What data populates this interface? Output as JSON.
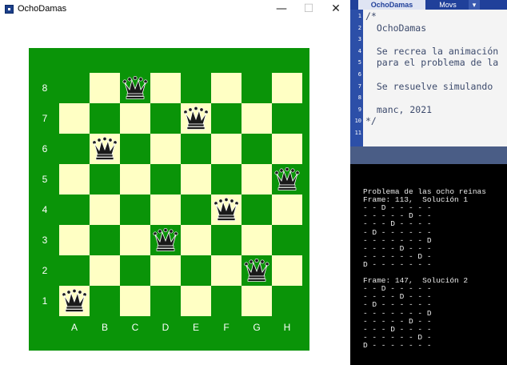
{
  "window": {
    "title": "OchoDamas",
    "minimize": "—",
    "maximize": "☐",
    "close": "✕"
  },
  "board": {
    "rank_labels": [
      "8",
      "7",
      "6",
      "5",
      "4",
      "3",
      "2",
      "1"
    ],
    "file_labels": [
      "A",
      "B",
      "C",
      "D",
      "E",
      "F",
      "G",
      "H"
    ],
    "queens": [
      {
        "file": "A",
        "rank": 1
      },
      {
        "file": "B",
        "rank": 6
      },
      {
        "file": "C",
        "rank": 8
      },
      {
        "file": "D",
        "rank": 3
      },
      {
        "file": "E",
        "rank": 7
      },
      {
        "file": "F",
        "rank": 4
      },
      {
        "file": "G",
        "rank": 2
      },
      {
        "file": "H",
        "rank": 5
      }
    ],
    "colors": {
      "border": "#0a9408",
      "dark": "#0a9408",
      "light": "#ffffc4",
      "label": "#ffffff",
      "queen": "#1a1a1a"
    }
  },
  "editor": {
    "tabs": {
      "file": "OchoDamas",
      "movs": "Movs",
      "arrow": "▾"
    },
    "line_numbers": [
      "1",
      "2",
      "3",
      "4",
      "5",
      "6",
      "7",
      "8",
      "9",
      "10",
      "11"
    ],
    "lines": [
      "/*",
      "  OchoDamas",
      "",
      "  Se recrea la animación",
      "  para el problema de la",
      "",
      "  Se resuelve simulando",
      "",
      "  manc, 2021",
      "*/",
      ""
    ]
  },
  "console": {
    "lines": [
      "Problema de las ocho reinas",
      "Frame: 113,  Solución 1",
      "- - D - - - - -",
      "- - - - - D - -",
      "- - - D - - - -",
      "- D - - - - - -",
      "- - - - - - - D",
      "- - - - D - - -",
      "- - - - - - D -",
      "D - - - - - - -",
      "",
      "Frame: 147,  Solución 2",
      "- - D - - - - -",
      "- - - - D - - -",
      "- D - - - - - -",
      "- - - - - - - D",
      "- - - - - D - -",
      "- - - D - - - -",
      "- - - - - - D -",
      "D - - - - - - -"
    ]
  }
}
